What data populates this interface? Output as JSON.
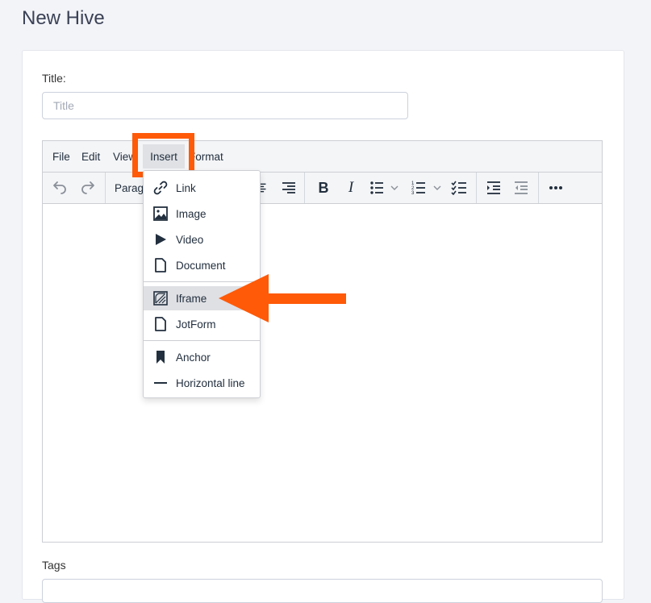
{
  "page": {
    "title": "New Hive"
  },
  "form": {
    "title_label": "Title:",
    "title_placeholder": "Title",
    "title_value": "",
    "tags_label": "Tags"
  },
  "editor": {
    "menubar": {
      "file": "File",
      "edit": "Edit",
      "view": "View",
      "insert": "Insert",
      "format": "Format"
    },
    "toolbar": {
      "undo_icon": "undo-icon",
      "redo_icon": "redo-icon",
      "block_format": "Paragraph",
      "align_center_icon": "align-center-icon",
      "align_right_icon": "align-right-icon",
      "bold_icon": "bold-icon",
      "italic_icon": "italic-icon",
      "bullet_list_icon": "bullet-list-icon",
      "numbered_list_icon": "numbered-list-icon",
      "checklist_icon": "checklist-icon",
      "indent_icon": "indent-icon",
      "outdent_icon": "outdent-icon",
      "more_icon": "more-icon"
    },
    "insert_menu": {
      "items": [
        {
          "label": "Link",
          "icon": "link-icon"
        },
        {
          "label": "Image",
          "icon": "image-icon"
        },
        {
          "label": "Video",
          "icon": "play-icon"
        },
        {
          "label": "Document",
          "icon": "document-icon"
        },
        {
          "label": "Iframe",
          "icon": "iframe-icon",
          "highlighted": true
        },
        {
          "label": "JotForm",
          "icon": "document-icon"
        },
        {
          "label": "Anchor",
          "icon": "bookmark-icon"
        },
        {
          "label": "Horizontal line",
          "icon": "horizontal-line-icon"
        }
      ]
    }
  },
  "colors": {
    "annotation_orange": "#ff5a08",
    "menu_highlight": "#dfe0e4",
    "text_dark": "#222f3e",
    "page_background": "#f3f4f8"
  }
}
